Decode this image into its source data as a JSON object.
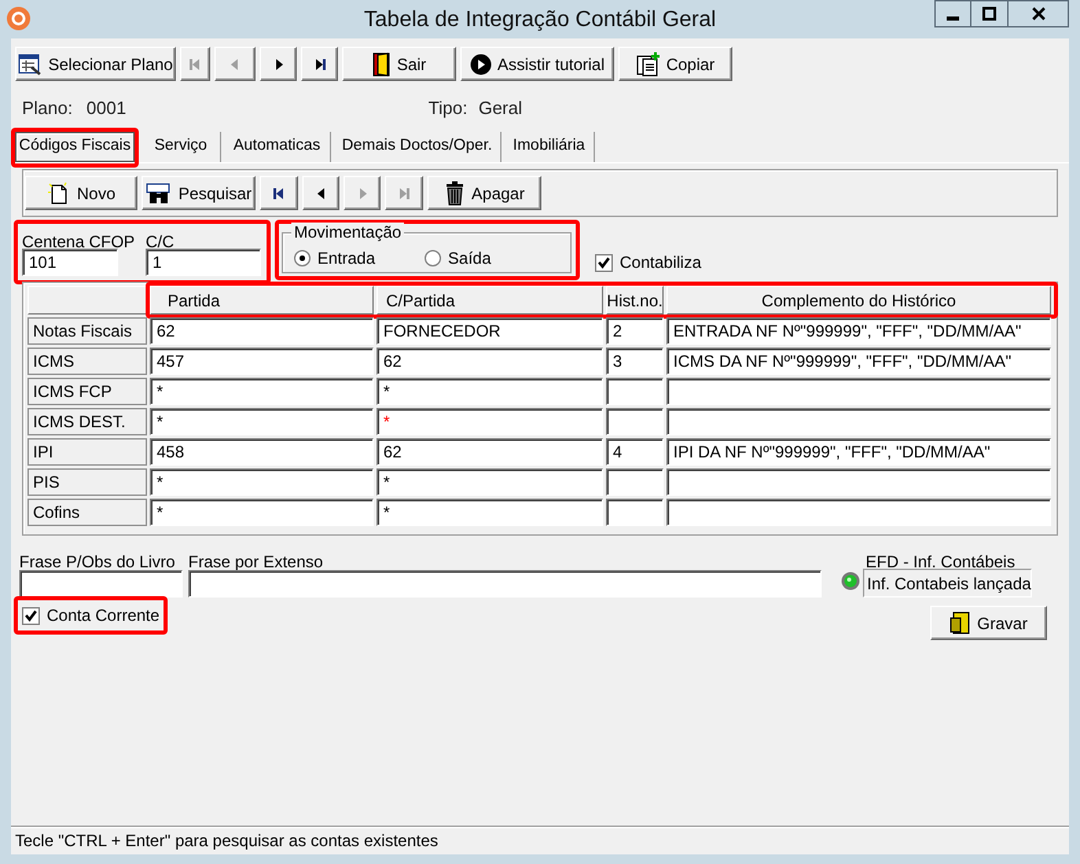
{
  "window": {
    "title": "Tabela de Integração Contábil Geral"
  },
  "toolbar": [
    {
      "kind": "select-plan",
      "label": "Selecionar Plano",
      "disabled": false
    },
    {
      "kind": "first",
      "disabled": true
    },
    {
      "kind": "prev",
      "disabled": true
    },
    {
      "kind": "next",
      "disabled": false
    },
    {
      "kind": "last",
      "disabled": false
    },
    {
      "kind": "exit",
      "label": "Sair",
      "disabled": false
    },
    {
      "kind": "tutorial",
      "label": "Assistir tutorial",
      "disabled": false
    },
    {
      "kind": "copy",
      "label": "Copiar",
      "disabled": false
    }
  ],
  "plan": {
    "label": "Plano:",
    "value": "0001",
    "type_label": "Tipo:",
    "type_value": "Geral"
  },
  "tabs": [
    {
      "label": "Códigos Fiscais",
      "selected": true
    },
    {
      "label": "Serviço",
      "selected": false
    },
    {
      "label": "Automaticas",
      "selected": false
    },
    {
      "label": "Demais Doctos/Oper.",
      "selected": false
    },
    {
      "label": "Imobiliária",
      "selected": false
    }
  ],
  "record_toolbar": [
    {
      "kind": "new",
      "label": "Novo",
      "disabled": false
    },
    {
      "kind": "search",
      "label": "Pesquisar",
      "disabled": false
    },
    {
      "kind": "first",
      "disabled": false
    },
    {
      "kind": "prev",
      "disabled": false
    },
    {
      "kind": "next",
      "disabled": true
    },
    {
      "kind": "last",
      "disabled": true
    },
    {
      "kind": "delete",
      "label": "Apagar",
      "disabled": false
    }
  ],
  "cfop": {
    "label": "Centena CFOP",
    "value": "101"
  },
  "cc": {
    "label": "C/C",
    "value": "1"
  },
  "movimentacao": {
    "label": "Movimentação",
    "options": [
      {
        "label": "Entrada",
        "selected": true
      },
      {
        "label": "Saída",
        "selected": false
      }
    ]
  },
  "contabiliza": {
    "label": "Contabiliza",
    "checked": true
  },
  "table": {
    "columns": [
      "Partida",
      "C/Partida",
      "Hist.no.",
      "Complemento do Histórico"
    ],
    "rows": [
      {
        "label": "Notas Fiscais",
        "partida": "62",
        "c_partida": "FORNECEDOR",
        "c_partida_invalid": false,
        "hist": "2",
        "complemento": "ENTRADA NF Nº\"999999\", \"FFF\", \"DD/MM/AA\""
      },
      {
        "label": "ICMS",
        "partida": "457",
        "c_partida": "62",
        "c_partida_invalid": false,
        "hist": "3",
        "complemento": "ICMS DA NF Nº\"999999\", \"FFF\", \"DD/MM/AA\""
      },
      {
        "label": "ICMS FCP",
        "partida": "*",
        "c_partida": "*",
        "c_partida_invalid": false
      },
      {
        "label": "ICMS DEST.",
        "partida": "*",
        "c_partida": "*",
        "c_partida_invalid": true
      },
      {
        "label": "IPI",
        "partida": "458",
        "c_partida": "62",
        "c_partida_invalid": false,
        "hist": "4",
        "complemento": "IPI DA NF Nº\"999999\", \"FFF\", \"DD/MM/AA\""
      },
      {
        "label": "PIS",
        "partida": "*",
        "c_partida": "*",
        "c_partida_invalid": false
      },
      {
        "label": "Cofins",
        "partida": "*",
        "c_partida": "*",
        "c_partida_invalid": false
      }
    ]
  },
  "frase_livro": {
    "label": "Frase P/Obs do Livro"
  },
  "frase_extenso": {
    "label": "Frase por Extenso"
  },
  "efd": {
    "label": "EFD - Inf. Contábeis",
    "value": "Inf. Contabeis lançada"
  },
  "conta_corrente": {
    "label": "Conta Corrente",
    "checked": true
  },
  "save_button": {
    "label": "Gravar"
  },
  "status_bar": "Tecle \"CTRL + Enter\" para pesquisar as contas existentes"
}
